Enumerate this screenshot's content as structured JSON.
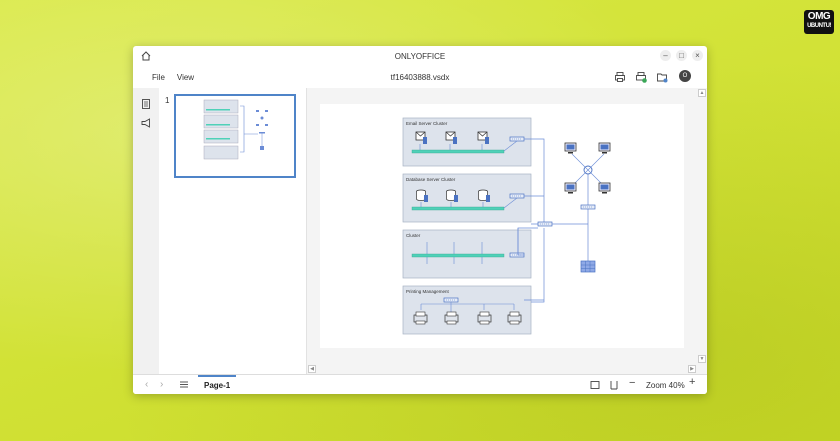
{
  "brand": {
    "logo_top": "OMG",
    "logo_sub": "UBUNTU!"
  },
  "window": {
    "app_title": "ONLYOFFICE",
    "file_name": "tf16403888.vsdx",
    "accent": "#4f84c8"
  },
  "menu": {
    "file": "File",
    "view": "View"
  },
  "user": {
    "initial": "O"
  },
  "thumbnail": {
    "number": "1"
  },
  "diagram": {
    "panels": [
      {
        "title": "Email Server Cluster"
      },
      {
        "title": "Database Server Cluster"
      },
      {
        "title": "Cluster"
      },
      {
        "title": "Printing Management"
      }
    ]
  },
  "status": {
    "page_tab": "Page-1",
    "zoom": "Zoom 40%"
  }
}
